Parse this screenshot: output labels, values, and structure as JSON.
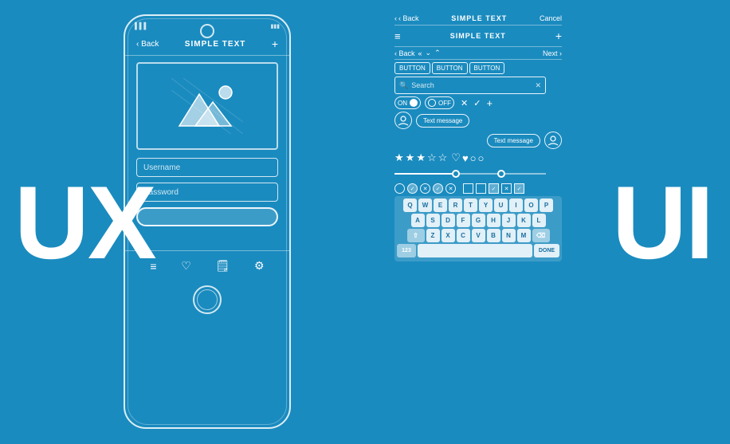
{
  "background_color": "#1a8bbf",
  "ux_label": "UX",
  "ui_label": "UI",
  "phone": {
    "signal": "▌▌▌",
    "battery": "▮▮▮",
    "back_label": "‹ Back",
    "title": "SIMPLE TEXT",
    "plus_icon": "+",
    "username_placeholder": "Username",
    "password_placeholder": "Password"
  },
  "panel": {
    "top_back": "‹ Back",
    "top_title": "SIMPLE TEXT",
    "top_cancel": "Cancel",
    "menu_icon": "≡",
    "title2": "SIMPLE TEXT",
    "plus2": "+",
    "nav_back": "‹ Back",
    "nav_prev": "«",
    "nav_down": "⌄",
    "nav_up": "⌃",
    "nav_next": "Next ›",
    "btn1": "BUTTON",
    "btn2": "BUTTON",
    "btn3": "BUTTON",
    "search_placeholder": "Search",
    "search_x": "✕",
    "toggle_on": "ON",
    "toggle_off": "OFF",
    "check": "✓",
    "cross": "✕",
    "plus3": "+",
    "text_message1": "Text message",
    "text_message2": "Text message",
    "stars": [
      "★",
      "★",
      "★",
      "☆",
      "☆"
    ],
    "hearts": [
      "♡",
      "♥",
      "○",
      "○"
    ],
    "keyboard": {
      "row1": [
        "Q",
        "W",
        "E",
        "R",
        "T",
        "Y",
        "U",
        "I",
        "O",
        "P"
      ],
      "row2": [
        "A",
        "S",
        "D",
        "F",
        "G",
        "H",
        "J",
        "K",
        "L"
      ],
      "row3": [
        "Z",
        "X",
        "C",
        "V",
        "B",
        "N",
        "M"
      ],
      "shift": "⇧",
      "delete": "⌫",
      "num": "123",
      "done": "DONE"
    }
  }
}
